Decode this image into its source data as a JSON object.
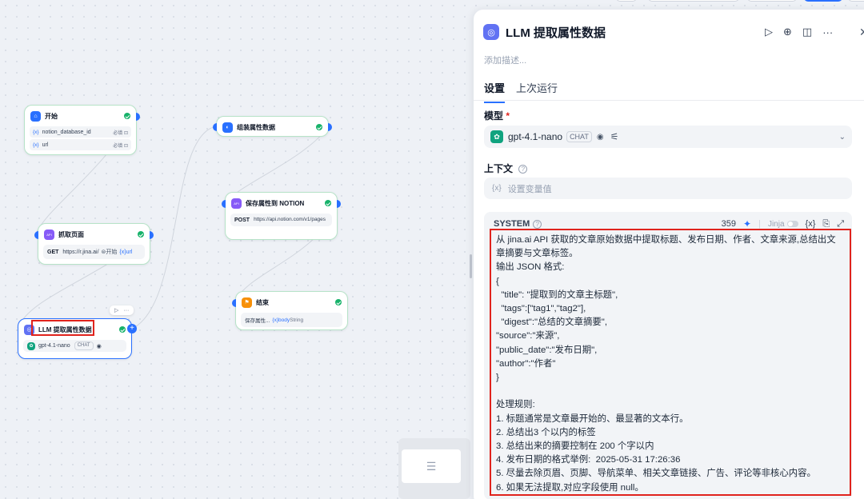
{
  "canvas": {
    "nodes": {
      "start": {
        "title": "开始",
        "vars": [
          {
            "name": "notion_database_id",
            "req": "必填"
          },
          {
            "name": "url",
            "req": "必填"
          }
        ]
      },
      "fetch": {
        "title": "抓取页面",
        "method": "GET",
        "url": "https://r.jina.ai/",
        "tag1": "⊜开始",
        "tag2": "{x}url"
      },
      "assemble": {
        "title": "组装属性数据"
      },
      "save": {
        "title": "保存属性到 NOTION",
        "method": "POST",
        "url": "https://api.notion.com/v1/pages"
      },
      "end": {
        "title": "结束",
        "var_prefix": "保存属性...",
        "var": "{x}body",
        "type": "String"
      },
      "llm": {
        "title": "LLM 提取属性数据",
        "model": "gpt-4.1-nano",
        "mode": "CHAT"
      }
    },
    "mini_toolbar": {
      "play": "▷",
      "more": "···"
    },
    "node_icons": {
      "start": "home-icon",
      "fetch": "api-icon",
      "assemble": "code-icon",
      "save": "api-icon",
      "end": "flag-icon",
      "llm": "llm-icon"
    }
  },
  "panel": {
    "title": "LLM 提取属性数据",
    "description_placeholder": "添加描述...",
    "tabs": [
      {
        "label": "设置",
        "active": true
      },
      {
        "label": "上次运行",
        "active": false
      }
    ],
    "model": {
      "label": "模型",
      "required_mark": "*",
      "name": "gpt-4.1-nano",
      "mode": "CHAT"
    },
    "context": {
      "label": "上下文",
      "placeholder": "设置变量值",
      "var_icon": "{x}"
    },
    "system": {
      "label": "SYSTEM",
      "count": "359",
      "jinja": "Jinja",
      "var_btn": "{x}",
      "content": "从 jina.ai API 获取的文章原始数据中提取标题、发布日期、作者、文章来源,总结出文章摘要与文章标签。\n输出 JSON 格式:\n{\n  \"title\": \"提取到的文章主标题\",\n  \"tags\":[\"tag1\",\"tag2\"],\n  \"digest\":\"总结的文章摘要\",\n\"source\":\"来源\",\n\"public_date\":\"发布日期\",\n\"author\":\"作者\"\n}\n\n处理规则:\n1. 标题通常是文章最开始的、最显著的文本行。\n2. 总结出3 个以内的标签\n3. 总结出来的摘要控制在 200 个字以内\n4. 发布日期的格式举例:  2025-05-31 17:26:36\n5. 尽量去除页眉、页脚、导航菜单、相关文章链接、广告、评论等非核心内容。\n6. 如果无法提取,对应字段使用 null。"
    }
  },
  "colors": {
    "accent": "#2970ff",
    "highlight": "#e0231d",
    "success": "#17b26a",
    "node_border": "#b7e3c8"
  }
}
